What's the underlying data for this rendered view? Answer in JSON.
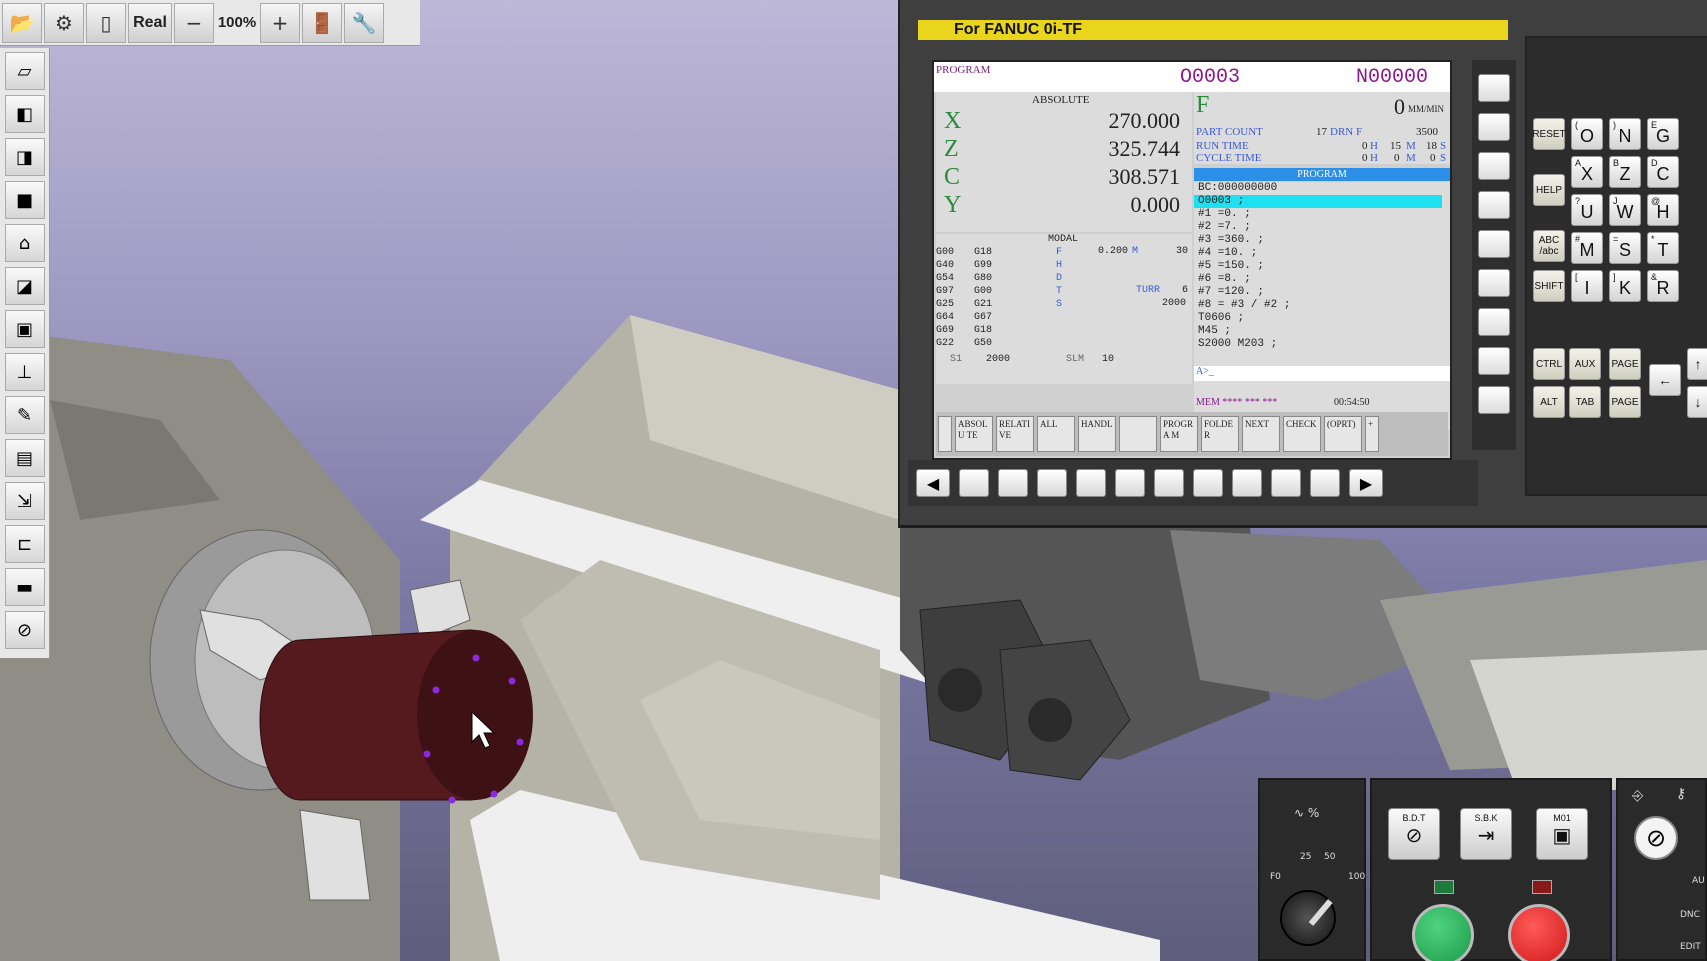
{
  "toolbar": {
    "real_label": "Real",
    "zoom_value": "100%",
    "minus_label": "−",
    "plus_label": "+"
  },
  "cnc": {
    "title": "For FANUC 0i-TF",
    "screen": {
      "mode_label": "PROGRAM",
      "program_number": "O0003",
      "sequence_number": "N00000",
      "absolute_label": "ABSOLUTE",
      "axes": [
        {
          "name": "X",
          "value": "270.000"
        },
        {
          "name": "Z",
          "value": "325.744"
        },
        {
          "name": "C",
          "value": "308.571"
        },
        {
          "name": "Y",
          "value": "0.000"
        }
      ],
      "feed_label": "F",
      "feed_value": "0",
      "feed_unit": "MM/MIN",
      "part_count_label": "PART COUNT",
      "part_count": "17",
      "drn_label": "DRN F",
      "drn_value": "3500",
      "run_time_label": "RUN TIME",
      "run_time_h": "0",
      "run_time_m": "15",
      "run_time_s": "18",
      "cycle_time_label": "CYCLE TIME",
      "cycle_time_h": "0",
      "cycle_time_m": "0",
      "cycle_time_s": "0",
      "unit_h": "H",
      "unit_m": "M",
      "unit_s": "S",
      "program_header": "PROGRAM",
      "program_lines": [
        "BC:000000000",
        "O0003 ;",
        "#1 =0. ;",
        "#2 =7. ;",
        "#3 =360. ;",
        "#4 =10. ;",
        "#5 =150. ;",
        "#6 =8. ;",
        "#7 =120. ;",
        "#8 = #3 / #2 ;",
        "T0606 ;",
        "M45 ;",
        "S2000 M203 ;"
      ],
      "input_prompt": "A>_",
      "modal_label": "MODAL",
      "modal_col1": [
        "G00",
        "G40",
        "G54",
        "G97",
        "G25",
        "G64",
        "G69",
        "G22"
      ],
      "modal_col2": [
        "G18",
        "G99",
        "G80",
        "G00",
        "G21",
        "G67",
        "G18",
        "G50"
      ],
      "modal_letters": [
        "F",
        "H",
        "D",
        "T",
        "S"
      ],
      "modal_f_value": "0.200",
      "modal_m_label": "M",
      "modal_m_value": "30",
      "turr_label": "TURR",
      "turr_value": "6",
      "modal_s_value": "2000",
      "s1_label": "S1",
      "s1_value": "2000",
      "slm_label": "SLM",
      "slm_value": "10",
      "status_text": "MEM **** *** ***",
      "clock": "00:54:50",
      "softkeys": [
        "ABSOLU TE",
        "RELATI VE",
        "ALL",
        "HANDL",
        "",
        "PROGRA M",
        "FOLDER",
        "NEXT",
        "CHECK",
        "(OPRT)",
        "+"
      ]
    },
    "keypad": {
      "reset": "RESET",
      "help": "HELP",
      "abc": "ABC /abc",
      "shift": "SHIFT",
      "ctrl": "CTRL",
      "aux": "AUX",
      "page_up": "PAGE",
      "alt": "ALT",
      "tab": "TAB",
      "page_down": "PAGE",
      "rows": [
        [
          {
            "sub": "(",
            "main": "O"
          },
          {
            "sub": ")",
            "main": "N"
          },
          {
            "sub": "E",
            "main": "G"
          }
        ],
        [
          {
            "sub": "A",
            "main": "X"
          },
          {
            "sub": "B",
            "main": "Z"
          },
          {
            "sub": "D",
            "main": "C"
          }
        ],
        [
          {
            "sub": "?",
            "main": "U"
          },
          {
            "sub": "J",
            "main": "W"
          },
          {
            "sub": "@",
            "main": "H"
          }
        ],
        [
          {
            "sub": "#",
            "main": "M"
          },
          {
            "sub": "=",
            "main": "S"
          },
          {
            "sub": "*",
            "main": "T"
          }
        ],
        [
          {
            "sub": "[",
            "main": "I"
          },
          {
            "sub": "]",
            "main": "K"
          },
          {
            "sub": "&",
            "main": "R"
          }
        ]
      ]
    }
  },
  "machine_panel": {
    "override_label": "%",
    "dial_marks": [
      "F0",
      "25",
      "50",
      "100"
    ],
    "bdt_label": "B.D.T",
    "sbk_label": "S.B.K",
    "m01_label": "M01",
    "dnc_label": "DNC",
    "edit_label": "EDIT",
    "auto_label": "AU"
  }
}
